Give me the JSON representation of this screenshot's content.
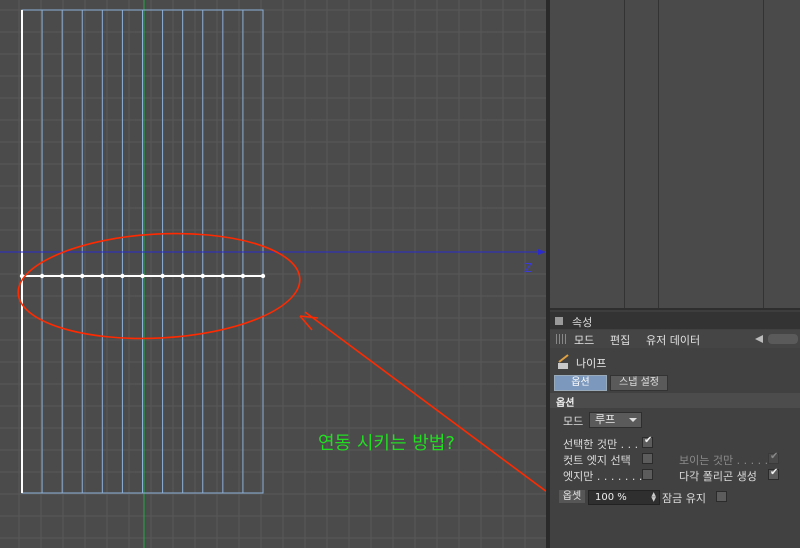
{
  "viewport": {
    "axis_label": "Z",
    "colors": {
      "background": "#4b4b4b",
      "grid": "#585858",
      "mesh_line": "#8db0d8",
      "axis_green": "#22aa44",
      "axis_blue": "#2b2bcc",
      "annotation": "#ff2a00"
    }
  },
  "annotation": {
    "question": "연동 시키는 방법?"
  },
  "attributes": {
    "title": "속성",
    "menu": [
      "모드",
      "편집",
      "유저 데이터"
    ],
    "tool_name": "나이프",
    "tabs": [
      "옵션",
      "스냅 설정"
    ],
    "section": "옵션",
    "mode_label": "모드",
    "mode_value": "루프",
    "only_selected_label": "선택한 것만 . . .",
    "visible_only_label": "보이는 것만 . . . . .",
    "cut_edge_select_label": "컷트 엣지 선택",
    "multi_polygon_label": "다각 폴리곤 생성",
    "edge_only_label": "엣지만 . . . . . . . .",
    "offset_label": "옵셋",
    "offset_value": "100 %",
    "lock_label": "잠금 유지"
  }
}
